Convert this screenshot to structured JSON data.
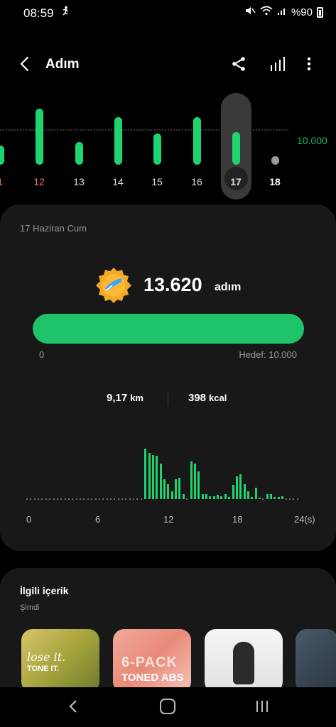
{
  "status_bar": {
    "time": "08:59",
    "battery_text": "%90"
  },
  "header": {
    "title": "Adım"
  },
  "week": {
    "goal_label": "10.000",
    "days": [
      {
        "label": "1",
        "value": 5500,
        "color": "#ff6b6b"
      },
      {
        "label": "12",
        "value": 15800,
        "color": "#ff6b6b"
      },
      {
        "label": "13",
        "value": 6400,
        "color": "#dddddd"
      },
      {
        "label": "14",
        "value": 13500,
        "color": "#dddddd"
      },
      {
        "label": "15",
        "value": 8900,
        "color": "#dddddd"
      },
      {
        "label": "16",
        "value": 13500,
        "color": "#dddddd"
      },
      {
        "label": "17",
        "value": 9300,
        "color": "#dddddd"
      },
      {
        "label": "18",
        "value": 300,
        "color": "#ffffff"
      }
    ],
    "selected_day": "17"
  },
  "card": {
    "date": "17 Haziran Cum",
    "steps": "13.620",
    "steps_unit": "adım",
    "progress_start": "0",
    "progress_goal": "Hedef: 10.000",
    "progress_fraction": 1.0,
    "distance": "9,17",
    "distance_unit": "km",
    "calories": "398",
    "calories_unit": "kcal",
    "hourly_axis": [
      "0",
      "6",
      "12",
      "18",
      "24(s)"
    ]
  },
  "chart_data": {
    "type": "bar",
    "xlabel": "",
    "ylabel": "",
    "x_range": [
      0,
      24
    ],
    "hourly_bins": [
      0,
      0,
      0,
      0,
      0,
      0,
      0,
      0,
      0,
      0,
      0,
      0,
      0,
      0,
      0,
      0,
      0,
      0,
      0,
      0,
      0,
      0,
      0,
      0,
      0,
      0,
      0,
      0,
      0,
      0,
      0,
      100,
      92,
      88,
      86,
      70,
      40,
      30,
      15,
      40,
      42,
      10,
      0,
      75,
      70,
      55,
      10,
      10,
      5,
      5,
      8,
      6,
      10,
      4,
      28,
      45,
      50,
      30,
      15,
      4,
      22,
      3,
      0,
      10,
      10,
      4,
      4,
      5,
      0,
      0,
      0,
      0
    ]
  },
  "related": {
    "title": "İlgili içerik",
    "subtitle": "Şimdi",
    "items": [
      {
        "caption": "lose it.",
        "caption2": "TONE IT."
      },
      {
        "caption": "6-PACK",
        "caption2": "TONED ABS"
      },
      {
        "caption": "",
        "caption2": ""
      },
      {
        "caption": "",
        "caption2": ""
      }
    ]
  }
}
